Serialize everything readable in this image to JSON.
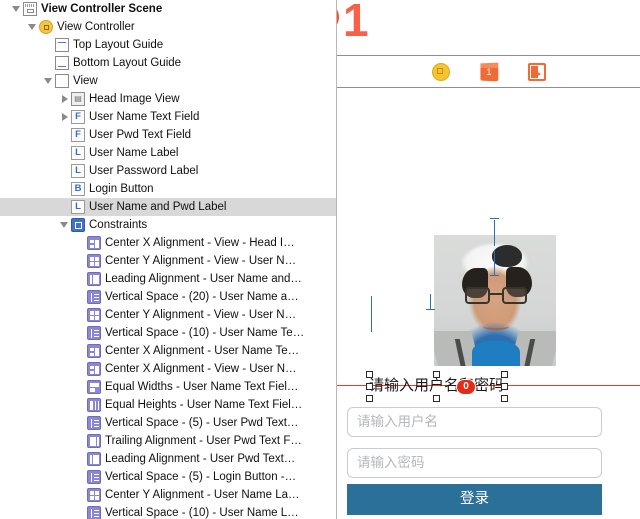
{
  "outline": {
    "rows": [
      {
        "indent": 0,
        "twisty": "open",
        "icon": "scene-icon",
        "icon_class": "ic-scene",
        "label": "View Controller Scene",
        "bold": true,
        "selected": false
      },
      {
        "indent": 1,
        "twisty": "open",
        "icon": "view-controller-icon",
        "icon_class": "ic-vc",
        "label": "View Controller",
        "bold": false,
        "selected": false
      },
      {
        "indent": 2,
        "twisty": "none",
        "icon": "top-layout-guide-icon",
        "icon_class": "ic-guide-top",
        "label": "Top Layout Guide",
        "bold": false,
        "selected": false
      },
      {
        "indent": 2,
        "twisty": "none",
        "icon": "bottom-layout-guide-icon",
        "icon_class": "ic-guide-bottom",
        "label": "Bottom Layout Guide",
        "bold": false,
        "selected": false
      },
      {
        "indent": 2,
        "twisty": "open",
        "icon": "view-icon",
        "icon_class": "ic-view",
        "label": "View",
        "bold": false,
        "selected": false
      },
      {
        "indent": 3,
        "twisty": "closed",
        "icon": "image-view-icon",
        "icon_class": "ic-image",
        "label": "Head Image View",
        "bold": false,
        "selected": false,
        "glyph": "ὛB"
      },
      {
        "indent": 3,
        "twisty": "closed",
        "icon": "text-field-icon",
        "icon_class": "ic-letter",
        "label": "User Name Text Field",
        "bold": false,
        "selected": false,
        "glyph": "F"
      },
      {
        "indent": 3,
        "twisty": "none",
        "icon": "text-field-icon",
        "icon_class": "ic-letter",
        "label": "User Pwd Text Field",
        "bold": false,
        "selected": false,
        "glyph": "F"
      },
      {
        "indent": 3,
        "twisty": "none",
        "icon": "label-icon",
        "icon_class": "ic-letter",
        "label": "User Name Label",
        "bold": false,
        "selected": false,
        "glyph": "L"
      },
      {
        "indent": 3,
        "twisty": "none",
        "icon": "label-icon",
        "icon_class": "ic-letter",
        "label": "User Password Label",
        "bold": false,
        "selected": false,
        "glyph": "L"
      },
      {
        "indent": 3,
        "twisty": "none",
        "icon": "button-icon",
        "icon_class": "ic-letter",
        "label": "Login Button",
        "bold": false,
        "selected": false,
        "glyph": "B"
      },
      {
        "indent": 3,
        "twisty": "none",
        "icon": "label-icon",
        "icon_class": "ic-letter",
        "label": "User Name and Pwd Label",
        "bold": false,
        "selected": true,
        "glyph": "L"
      },
      {
        "indent": 3,
        "twisty": "open",
        "icon": "constraints-folder-icon",
        "icon_class": "ic-constraints",
        "label": "Constraints",
        "bold": false,
        "selected": false
      },
      {
        "indent": 4,
        "twisty": "none",
        "icon": "center-x-alignment-icon",
        "icon_class": "ic-cons cx",
        "label": "Center X Alignment - View - Head I…",
        "bold": false,
        "selected": false
      },
      {
        "indent": 4,
        "twisty": "none",
        "icon": "center-y-alignment-icon",
        "icon_class": "ic-cons cy",
        "label": "Center Y Alignment - View - User N…",
        "bold": false,
        "selected": false
      },
      {
        "indent": 4,
        "twisty": "none",
        "icon": "leading-alignment-icon",
        "icon_class": "ic-cons lead",
        "label": "Leading Alignment - User Name and…",
        "bold": false,
        "selected": false
      },
      {
        "indent": 4,
        "twisty": "none",
        "icon": "vertical-space-icon",
        "icon_class": "ic-cons vspace",
        "label": "Vertical Space - (20) - User Name a…",
        "bold": false,
        "selected": false
      },
      {
        "indent": 4,
        "twisty": "none",
        "icon": "center-y-alignment-icon",
        "icon_class": "ic-cons cy",
        "label": "Center Y Alignment - View - User N…",
        "bold": false,
        "selected": false
      },
      {
        "indent": 4,
        "twisty": "none",
        "icon": "vertical-space-icon",
        "icon_class": "ic-cons vspace",
        "label": "Vertical Space - (10) - User Name Te…",
        "bold": false,
        "selected": false
      },
      {
        "indent": 4,
        "twisty": "none",
        "icon": "center-x-alignment-icon",
        "icon_class": "ic-cons cx",
        "label": "Center X Alignment - User Name Te…",
        "bold": false,
        "selected": false
      },
      {
        "indent": 4,
        "twisty": "none",
        "icon": "center-x-alignment-icon",
        "icon_class": "ic-cons cx",
        "label": "Center X Alignment - View - User N…",
        "bold": false,
        "selected": false
      },
      {
        "indent": 4,
        "twisty": "none",
        "icon": "equal-widths-icon",
        "icon_class": "ic-cons eqw",
        "label": "Equal Widths - User Name Text Fiel…",
        "bold": false,
        "selected": false
      },
      {
        "indent": 4,
        "twisty": "none",
        "icon": "equal-heights-icon",
        "icon_class": "ic-cons eqh",
        "label": "Equal Heights - User Name Text Fiel…",
        "bold": false,
        "selected": false
      },
      {
        "indent": 4,
        "twisty": "none",
        "icon": "vertical-space-icon",
        "icon_class": "ic-cons vspace",
        "label": "Vertical Space - (5) - User Pwd Text…",
        "bold": false,
        "selected": false
      },
      {
        "indent": 4,
        "twisty": "none",
        "icon": "trailing-alignment-icon",
        "icon_class": "ic-cons trail",
        "label": "Trailing Alignment - User Pwd Text F…",
        "bold": false,
        "selected": false
      },
      {
        "indent": 4,
        "twisty": "none",
        "icon": "leading-alignment-icon",
        "icon_class": "ic-cons lead",
        "label": "Leading Alignment - User Pwd Text…",
        "bold": false,
        "selected": false
      },
      {
        "indent": 4,
        "twisty": "none",
        "icon": "vertical-space-icon",
        "icon_class": "ic-cons vspace",
        "label": "Vertical Space - (5) - Login Button -…",
        "bold": false,
        "selected": false
      },
      {
        "indent": 4,
        "twisty": "none",
        "icon": "center-y-alignment-icon",
        "icon_class": "ic-cons cy",
        "label": "Center Y Alignment - User Name La…",
        "bold": false,
        "selected": false
      },
      {
        "indent": 4,
        "twisty": "none",
        "icon": "vertical-space-icon",
        "icon_class": "ic-cons vspace",
        "label": "Vertical Space - (10) - User Name L…",
        "bold": false,
        "selected": false
      }
    ]
  },
  "marker": {
    "number": "1"
  },
  "dock": {
    "items": [
      {
        "name": "view-controller-dock-icon",
        "class": "di-vc",
        "glyph": ""
      },
      {
        "name": "first-responder-dock-icon",
        "class": "di-fr",
        "glyph": "1"
      },
      {
        "name": "exit-dock-icon",
        "class": "di-exit",
        "glyph": ""
      }
    ]
  },
  "canvas": {
    "selected_label_text": "请输入用户名和密码",
    "error_badge_count": "0",
    "username_placeholder": "请输入用户名",
    "password_placeholder": "请输入密码",
    "login_button_label": "登录"
  },
  "colors": {
    "login_button_bg": "#2b7099",
    "error_badge_bg": "#e32b18",
    "guide_red": "#ee3b24",
    "constraint_blue": "#2f6fb5",
    "marker_red": "#f8604a",
    "selection_gray": "#d8d8d8"
  }
}
